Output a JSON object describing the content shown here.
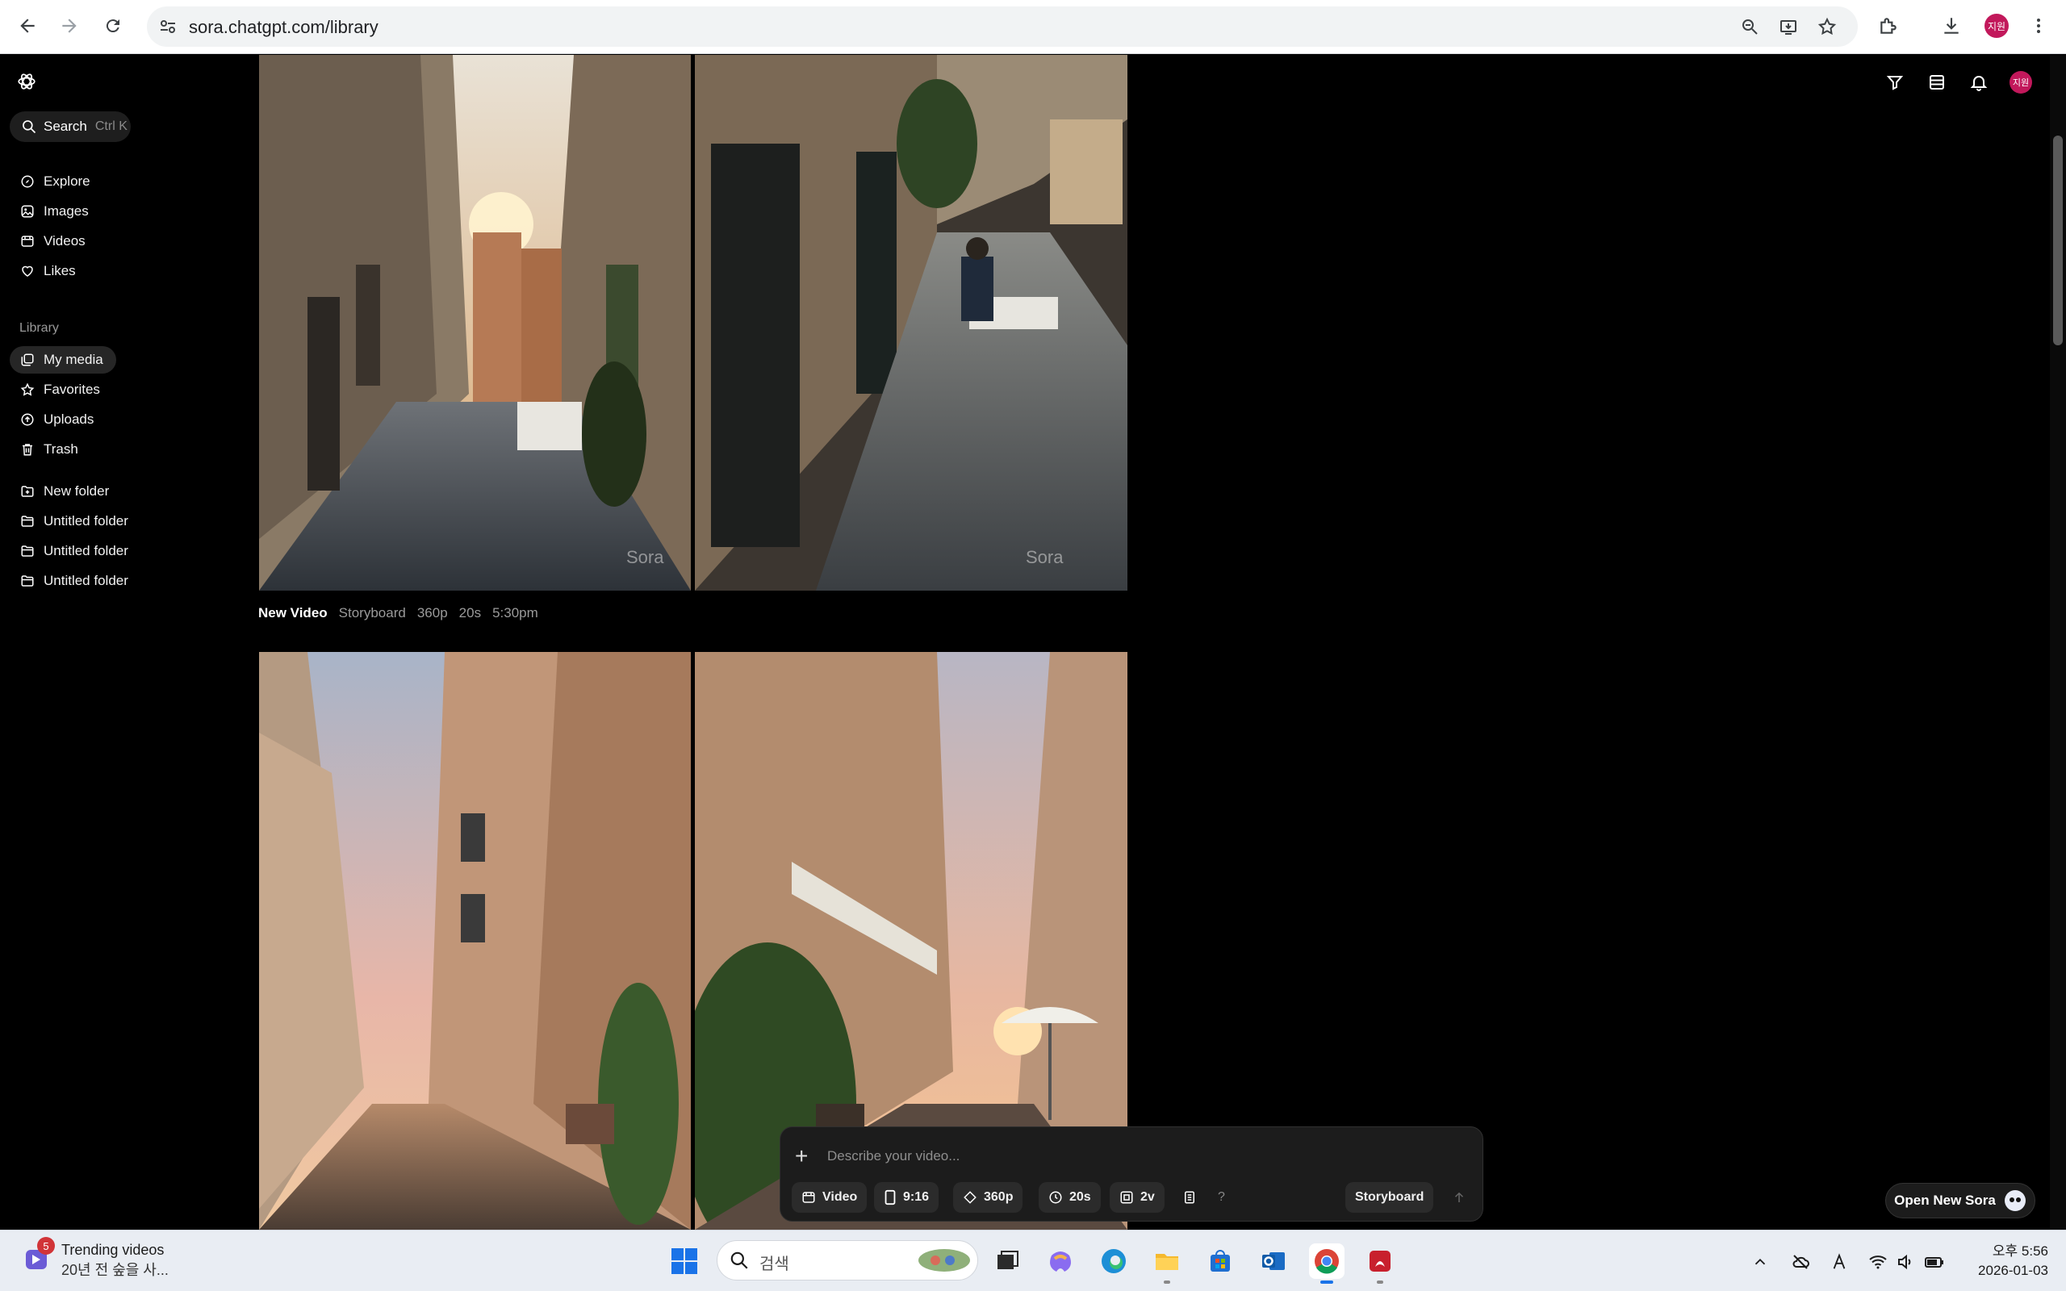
{
  "browser": {
    "url": "sora.chatgpt.com/library",
    "profile_badge": "지원"
  },
  "sidebar": {
    "search": {
      "label": "Search",
      "shortcut": "Ctrl K"
    },
    "nav": [
      {
        "label": "Explore",
        "icon": "compass-icon"
      },
      {
        "label": "Images",
        "icon": "images-icon"
      },
      {
        "label": "Videos",
        "icon": "video-icon"
      },
      {
        "label": "Likes",
        "icon": "heart-icon"
      }
    ],
    "library_label": "Library",
    "library_items": [
      {
        "label": "My media",
        "icon": "media-icon",
        "active": true
      },
      {
        "label": "Favorites",
        "icon": "star-icon"
      },
      {
        "label": "Uploads",
        "icon": "upload-icon"
      },
      {
        "label": "Trash",
        "icon": "trash-icon"
      }
    ],
    "folders": [
      {
        "label": "New folder",
        "icon": "folder-plus-icon"
      },
      {
        "label": "Untitled folder",
        "icon": "folder-icon"
      },
      {
        "label": "Untitled folder",
        "icon": "folder-icon"
      },
      {
        "label": "Untitled folder",
        "icon": "folder-icon"
      }
    ]
  },
  "header": {
    "avatar": "지원"
  },
  "media": {
    "group1": {
      "title": "New Video",
      "mode": "Storyboard",
      "resolution": "360p",
      "duration": "20s",
      "time": "5:30pm"
    }
  },
  "composer": {
    "placeholder": "Describe your video...",
    "type": "Video",
    "aspect": "9:16",
    "resolution": "360p",
    "duration": "20s",
    "variations": "2v",
    "help": "?",
    "storyboard": "Storyboard"
  },
  "open_new_sora": "Open New Sora",
  "taskbar": {
    "news_badge": "5",
    "news_title": "Trending videos",
    "news_sub": "20년 전 숲을 사...",
    "search_placeholder": "검색",
    "time": "오후 5:56",
    "date": "2026-01-03"
  }
}
